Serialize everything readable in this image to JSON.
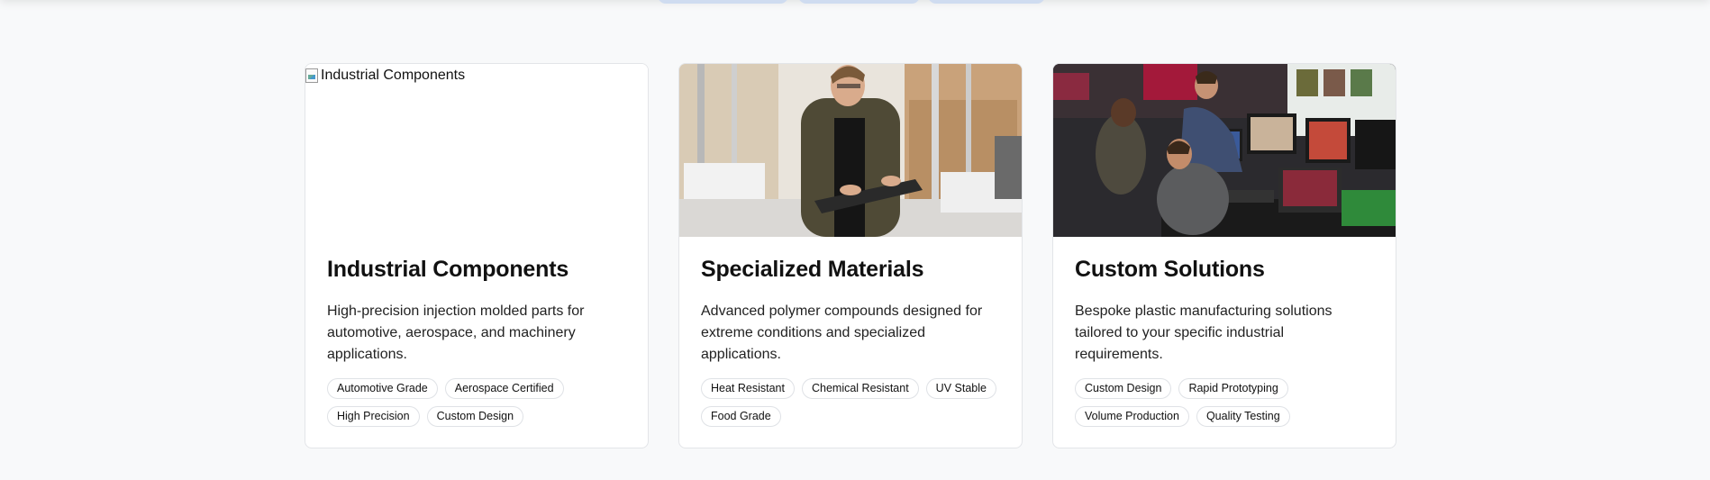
{
  "cards": [
    {
      "title": "Industrial Components",
      "image_alt": "Industrial Components",
      "image_state": "broken",
      "description": "High-precision injection molded parts for automotive, aerospace, and machinery applications.",
      "tags": [
        "Automotive Grade",
        "Aerospace Certified",
        "High Precision",
        "Custom Design"
      ]
    },
    {
      "title": "Specialized Materials",
      "image_alt": "Specialized Materials",
      "image_state": "photo",
      "description": "Advanced polymer compounds designed for extreme conditions and specialized applications.",
      "tags": [
        "Heat Resistant",
        "Chemical Resistant",
        "UV Stable",
        "Food Grade"
      ]
    },
    {
      "title": "Custom Solutions",
      "image_alt": "Custom Solutions",
      "image_state": "photo",
      "description": "Bespoke plastic manufacturing solutions tailored to your specific industrial requirements.",
      "tags": [
        "Custom Design",
        "Rapid Prototyping",
        "Volume Production",
        "Quality Testing"
      ]
    }
  ],
  "colors": {
    "page_background": "#f8f9fa",
    "card_border": "#e3e5e8",
    "tag_border": "#dfe2e6",
    "header_chip": "#cfdcf0"
  }
}
